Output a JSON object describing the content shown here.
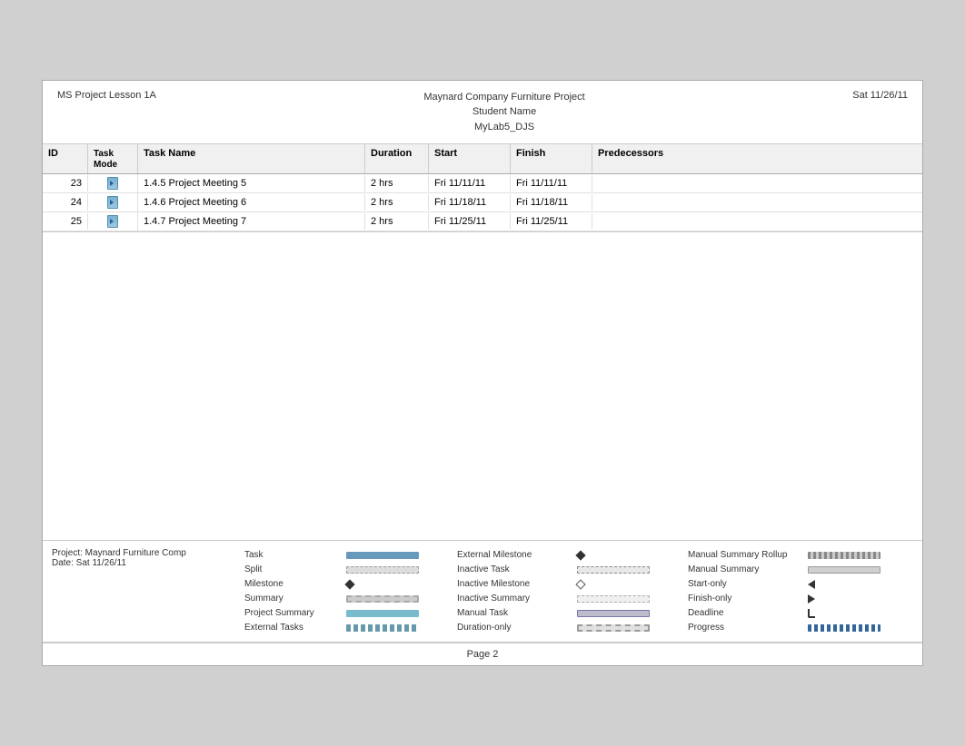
{
  "header": {
    "left": "MS Project Lesson 1A",
    "center_line1": "Maynard Company Furniture Project",
    "center_line2": "Student Name",
    "center_line3": "MyLab5_DJS",
    "right": "Sat 11/26/11"
  },
  "table": {
    "columns": {
      "id": "ID",
      "task_mode": "Task\nMode",
      "task_name": "Task Name",
      "duration": "Duration",
      "start": "Start",
      "finish": "Finish",
      "predecessors": "Predecessors"
    },
    "rows": [
      {
        "id": "23",
        "task_mode": "icon",
        "task_name": "1.4.5 Project Meeting 5",
        "duration": "2 hrs",
        "start": "Fri 11/11/11",
        "finish": "Fri 11/11/11",
        "predecessors": ""
      },
      {
        "id": "24",
        "task_mode": "icon",
        "task_name": "1.4.6 Project Meeting 6",
        "duration": "2 hrs",
        "start": "Fri 11/18/11",
        "finish": "Fri 11/18/11",
        "predecessors": ""
      },
      {
        "id": "25",
        "task_mode": "icon",
        "task_name": "1.4.7 Project Meeting 7",
        "duration": "2 hrs",
        "start": "Fri 11/25/11",
        "finish": "Fri 11/25/11",
        "predecessors": ""
      }
    ]
  },
  "legend": {
    "project_info_line1": "Project: Maynard Furniture Comp",
    "project_info_line2": "Date: Sat 11/26/11",
    "items": [
      {
        "label": "Task",
        "symbol": "solid-bar"
      },
      {
        "label": "Split",
        "symbol": "split-bar"
      },
      {
        "label": "Milestone",
        "symbol": "diamond"
      },
      {
        "label": "Summary",
        "symbol": "summary"
      },
      {
        "label": "Project Summary",
        "symbol": "project-summary"
      },
      {
        "label": "External Tasks",
        "symbol": "external"
      },
      {
        "label": "External Milestone",
        "symbol": "ext-milestone"
      },
      {
        "label": "Inactive Task",
        "symbol": "inactive-task"
      },
      {
        "label": "Inactive Milestone",
        "symbol": "inactive-milestone"
      },
      {
        "label": "Inactive Summary",
        "symbol": "inactive-summary"
      },
      {
        "label": "Manual Task",
        "symbol": "manual-task"
      },
      {
        "label": "Duration-only",
        "symbol": "duration-only"
      },
      {
        "label": "Manual Summary Rollup",
        "symbol": "manual-summary-rollup"
      },
      {
        "label": "Manual Summary",
        "symbol": "manual-summary"
      },
      {
        "label": "Start-only",
        "symbol": "start-only"
      },
      {
        "label": "Finish-only",
        "symbol": "finish-only"
      },
      {
        "label": "Deadline",
        "symbol": "deadline"
      },
      {
        "label": "Progress",
        "symbol": "progress"
      }
    ]
  },
  "page": {
    "number": "Page 2"
  }
}
